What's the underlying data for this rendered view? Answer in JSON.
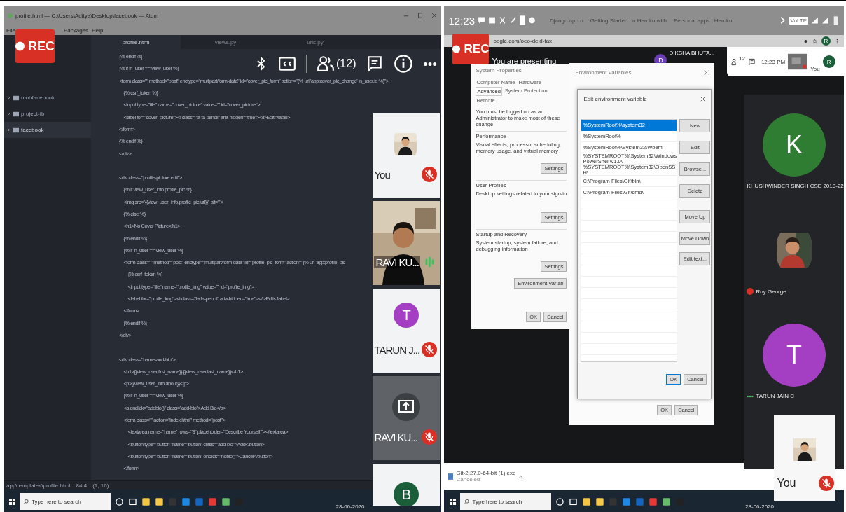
{
  "left": {
    "window_title": "profile.html — C:\\Users\\Aditya\\Desktop\\facebook — Atom",
    "menu": [
      "File",
      "Packages",
      "Help"
    ],
    "rec": "REC",
    "tree": [
      {
        "label": "mnbfacebook",
        "selected": false
      },
      {
        "label": "project-fb",
        "selected": false
      },
      {
        "label": "facebook",
        "selected": true
      }
    ],
    "tabs": [
      {
        "label": "profile.html",
        "selected": true
      },
      {
        "label": "views.py",
        "selected": false
      },
      {
        "label": "urls.py",
        "selected": false
      }
    ],
    "code": [
      {
        "kind": "code",
        "text": "{% endif %}"
      },
      {
        "kind": "code",
        "text": "{% if in_user == view_user %}"
      },
      {
        "kind": "code",
        "text": "<form class=\"\" method=\"post\" enctype=\"multipart/form-data\" id=\"cover_pic_form\" action=\"{% url 'app:cover_pic_change' in_user.id %}\">"
      },
      {
        "kind": "code",
        "text": "    {% csrf_token %}"
      },
      {
        "kind": "code",
        "text": "    <input type=\"file\" name=\"cover_picture\" value=\"\" id=\"cover_picture\">"
      },
      {
        "kind": "code",
        "text": "    <label for=\"cover_picture\"><i class=\"fa fa-pencil\" aria-hidden=\"true\"></i>Edit</label>"
      },
      {
        "kind": "code",
        "text": "</form>"
      },
      {
        "kind": "code",
        "text": "{% endif %}"
      },
      {
        "kind": "code",
        "text": "</div>"
      },
      {
        "kind": "blank"
      },
      {
        "kind": "code",
        "text": "<div class=\"profile-picture edit\">"
      },
      {
        "kind": "code",
        "text": "    {% if view_user_info.profile_pic %}"
      },
      {
        "kind": "code",
        "text": "    <img src=\"{{view_user_info.profile_pic.url}}\" alt=\"\">"
      },
      {
        "kind": "code",
        "text": "    {% else %}"
      },
      {
        "kind": "code",
        "text": "    <h1>No Cover Picture</h1>"
      },
      {
        "kind": "code",
        "text": "    {% endif %}"
      },
      {
        "kind": "code",
        "text": "    {% if in_user == view_user %}"
      },
      {
        "kind": "code",
        "text": "    <form class=\"\" method=\"post\" enctype=\"multipart/form-data\" id=\"profile_pic_form\" action=\"{% url 'app:profile_pic"
      },
      {
        "kind": "code",
        "text": "        {% csrf_token %}"
      },
      {
        "kind": "code",
        "text": "        <input type=\"file\" name=\"profile_img\" value=\"\" id=\"profile_img\">"
      },
      {
        "kind": "code",
        "text": "        <label for=\"profile_img\"><i class=\"fa fa-pencil\" aria-hidden=\"true\"></i>Edit</label>"
      },
      {
        "kind": "code",
        "text": "    </form>"
      },
      {
        "kind": "code",
        "text": "    {% endif %}"
      },
      {
        "kind": "code",
        "text": "</div>"
      },
      {
        "kind": "blank"
      },
      {
        "kind": "code",
        "text": "<div class=\"name-and-bio\">"
      },
      {
        "kind": "code",
        "text": "    <h1>{{view_user.first_name}} {{view_user.last_name}}</h1>"
      },
      {
        "kind": "code",
        "text": "    <p>{{view_user_info.about}}</p>"
      },
      {
        "kind": "code",
        "text": "    {% if in_user == view_user %}"
      },
      {
        "kind": "code",
        "text": "    <a onclick=\"addbio()\" class=\"add-bio\">Add Bio</a>"
      },
      {
        "kind": "code",
        "text": "    <form class=\"\" action=\"index.html\" method=\"post\">"
      },
      {
        "kind": "code",
        "text": "        <textarea name=\"name\" rows=\"8\" placeholder=\"Describe Yourself \"></textarea>"
      },
      {
        "kind": "code",
        "text": "        <button type=\"button\" name=\"button\" class=\"add-bio\">Add</button>"
      },
      {
        "kind": "code",
        "text": "        <button type=\"button\" name=\"button\" onclick=\"nobio()\">Cancel</button>"
      },
      {
        "kind": "code",
        "text": "    </form>"
      }
    ],
    "meet": {
      "participants": "(12)"
    },
    "tiles": [
      {
        "kind": "avatar_photo",
        "name": "You",
        "muted": true,
        "speaking": false
      },
      {
        "kind": "video",
        "name": "RAVI KU...",
        "muted": false,
        "speaking": true
      },
      {
        "kind": "letter",
        "letter": "T",
        "color": "#a43fc4",
        "name": "TARUN J...",
        "muted": true,
        "speaking": false
      },
      {
        "kind": "presenting",
        "name": "RAVI KU...",
        "muted": true,
        "speaking": false
      },
      {
        "kind": "letter",
        "letter": "B",
        "color": "#1b5e3a",
        "muted": false,
        "speaking": false
      }
    ],
    "status_bar": {
      "path": "app\\templates\\profile.html",
      "cursor": "84:4",
      "selection": "(1, 16)"
    },
    "taskbar": {
      "search": "Type here to search",
      "date": "28-06-2020"
    }
  },
  "right": {
    "phone_time": "12:23",
    "volte": "VoLTE",
    "browser_tabs": [
      "Django app o",
      "Getting Started on Heroku with",
      "Personal apps | Heroku"
    ],
    "address": "oogle.com/oeo-deid-fax",
    "rec": "REC",
    "presenting": "You are presenting",
    "presenter": {
      "initial": "D",
      "name": "DIKSHA BHUTA..."
    },
    "participant_count": "12",
    "clock": "12:23 PM",
    "self_label": "You",
    "self_initial": "R",
    "browser_profile_initial": "R",
    "system_properties": {
      "title": "System Properties",
      "tabs": [
        {
          "label": "Computer Name",
          "selected": false
        },
        {
          "label": "Hardware",
          "selected": false
        },
        {
          "label": "Advanced",
          "selected": true
        },
        {
          "label": "System Protection",
          "selected": false
        },
        {
          "label": "Remote",
          "selected": false
        }
      ],
      "note": "You must be logged on as an Administrator to make most of these change",
      "groups": [
        {
          "title": "Performance",
          "text": "Visual effects, processor scheduling, memory usage, and virtual memory",
          "button": "Settings"
        },
        {
          "title": "User Profiles",
          "text": "Desktop settings related to your sign-in",
          "button": "Settings"
        },
        {
          "title": "Startup and Recovery",
          "text": "System startup, system failure, and debugging information",
          "button": "Settings"
        }
      ],
      "env_button": "Environment Variab",
      "buttons": [
        "OK",
        "Cancel"
      ]
    },
    "env_variables": {
      "title": "Environment Variables",
      "buttons": [
        "OK",
        "Cancel"
      ]
    },
    "edit_env": {
      "title": "Edit environment variable",
      "entries": [
        {
          "text": "%SystemRoot%\\system32",
          "selected": true
        },
        {
          "text": "%SystemRoot%",
          "selected": false
        },
        {
          "text": "%SystemRoot%\\System32\\Wbem",
          "selected": false
        },
        {
          "text": "%SYSTEMROOT%\\System32\\WindowsPowerShell\\v1.0\\",
          "selected": false
        },
        {
          "text": "%SYSTEMROOT%\\System32\\OpenSSH\\",
          "selected": false
        },
        {
          "text": "C:\\Program Files\\Git\\bin\\",
          "selected": false
        },
        {
          "text": "C:\\Program Files\\Git\\cmd\\",
          "selected": false
        }
      ],
      "side_buttons": [
        [
          "New",
          "Edit",
          "Browse...",
          "Delete"
        ],
        [
          "Move Up",
          "Move Down"
        ],
        [
          "Edit text..."
        ]
      ],
      "buttons": [
        "OK",
        "Cancel"
      ]
    },
    "tiles": [
      {
        "kind": "letter",
        "letter": "K",
        "color": "#2e7d32",
        "name": "KHUSHWINDER SINGH CSE 2018-22"
      },
      {
        "name": "Roy George"
      },
      {
        "kind": "letter",
        "letter": "T",
        "color": "#a43fc4",
        "name": "TARUN JAIN C"
      }
    ],
    "self_tile": {
      "name": "You",
      "muted": true
    },
    "download": {
      "file": "Git-2.27.0-64-bit (1).exe",
      "status": "Canceled"
    },
    "taskbar": {
      "search": "Type here to search",
      "date": "28-06-2020"
    }
  }
}
